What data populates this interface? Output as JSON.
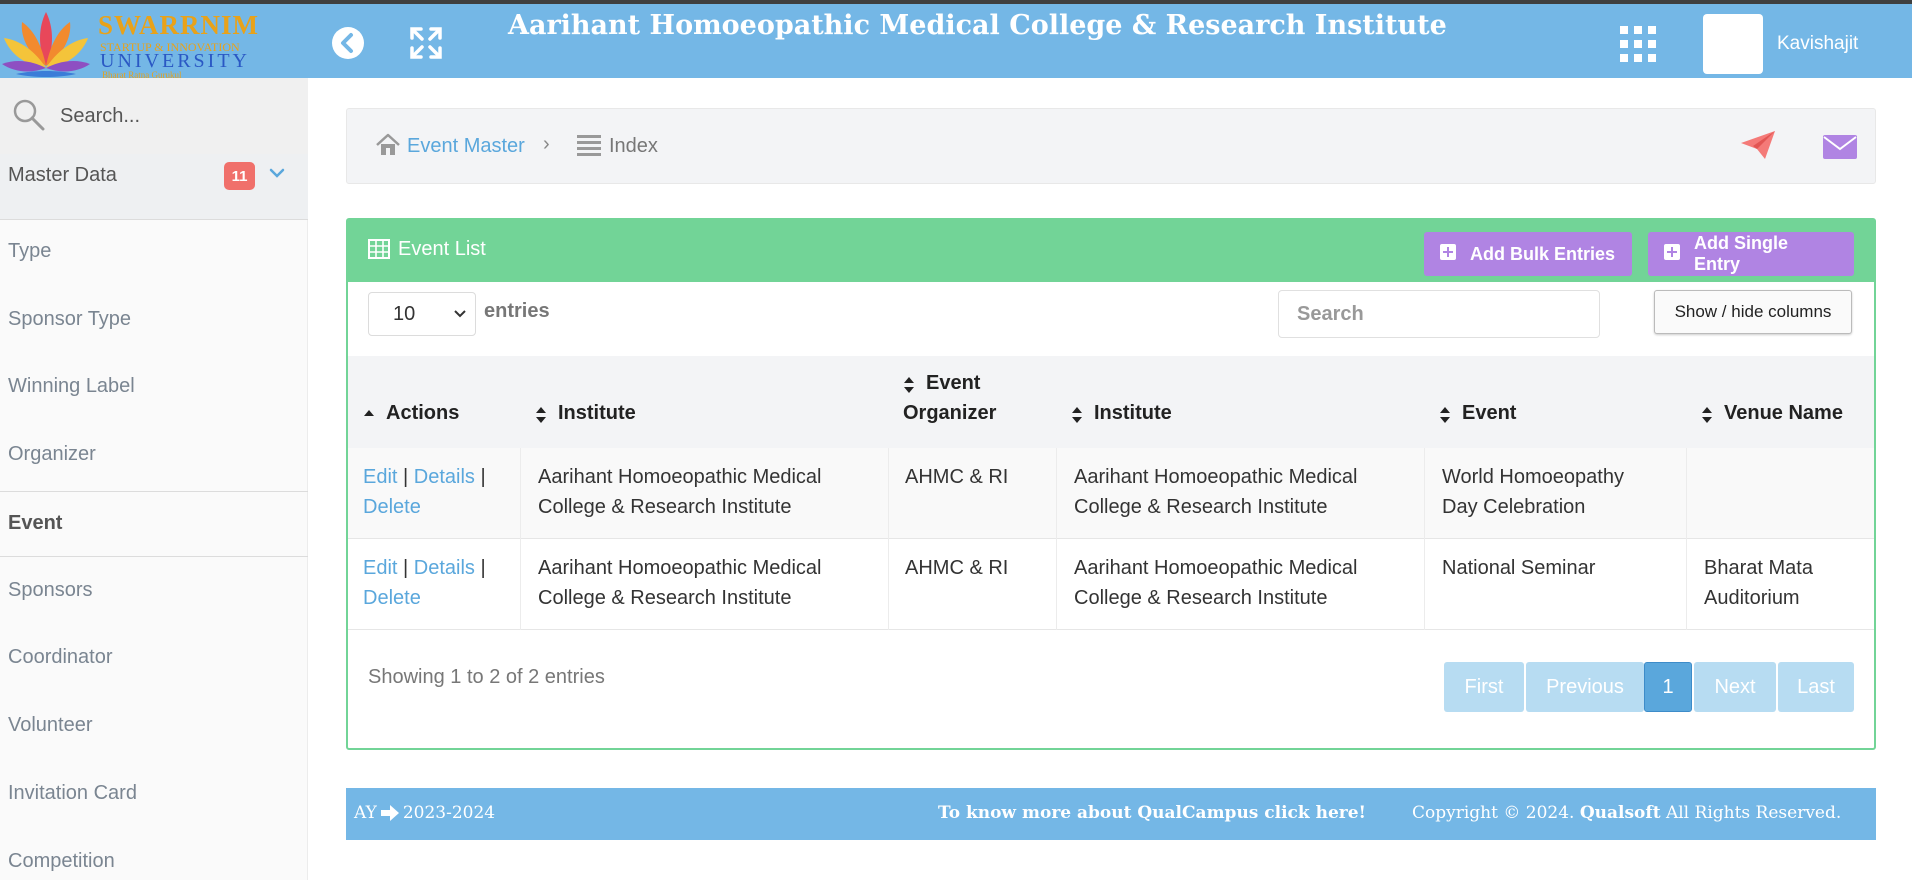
{
  "header": {
    "logo": {
      "line1": "SWARRNIM",
      "line2": "STARTUP & INNOVATION",
      "line3": "UNIVERSITY",
      "tagline": "Bharat Ratna Gurukul"
    },
    "title": "Aarihant Homoeopathic Medical College & Research Institute",
    "username": "Kavishajit",
    "colors": {
      "bar": "#74b7e6",
      "logo_gold": "#e8a21a",
      "logo_blue": "#2a58c4"
    },
    "icons": [
      "back-circle-icon",
      "fullscreen-icon",
      "apps-grid-icon"
    ]
  },
  "sidebar": {
    "search_placeholder": "Search...",
    "group": {
      "label": "Master Data",
      "badge": "11"
    },
    "items": [
      {
        "label": "Type"
      },
      {
        "label": "Sponsor Type"
      },
      {
        "label": "Winning Label"
      },
      {
        "label": "Organizer"
      },
      {
        "label": "Event",
        "active": true
      },
      {
        "label": "Sponsors"
      },
      {
        "label": "Coordinator"
      },
      {
        "label": "Volunteer"
      },
      {
        "label": "Invitation Card"
      },
      {
        "label": "Competition"
      }
    ]
  },
  "breadcrumb": {
    "link": "Event Master",
    "current": "Index",
    "icons": [
      "home-icon",
      "list-icon",
      "paper-plane-icon",
      "envelope-icon"
    ]
  },
  "panel": {
    "title": "Event List",
    "add_bulk_label": "Add Bulk Entries",
    "add_single_label": "Add Single Entry",
    "length_value": "10",
    "entries_label": "entries",
    "search_placeholder": "Search",
    "show_hide_label": "Show / hide columns",
    "colors": {
      "header": "#72d497",
      "button": "#b084e3"
    }
  },
  "table": {
    "columns": [
      {
        "label": "Actions",
        "line2": ""
      },
      {
        "label": "Institute",
        "line2": ""
      },
      {
        "label": "Event",
        "line2": "Organizer"
      },
      {
        "label": "Institute",
        "line2": ""
      },
      {
        "label": "Event",
        "line2": ""
      },
      {
        "label": "Venue Name",
        "line2": ""
      }
    ],
    "actions": {
      "edit": "Edit",
      "details": "Details",
      "delete": "Delete",
      "sep": "|"
    },
    "rows": [
      {
        "institute_1": "Aarihant Homoeopathic Medical",
        "institute_2": "College & Research Institute",
        "organizer": "AHMC & RI",
        "inst2_1": "Aarihant Homoeopathic Medical",
        "inst2_2": "College & Research Institute",
        "event_1": "World Homoeopathy",
        "event_2": "Day Celebration",
        "venue_1": "",
        "venue_2": ""
      },
      {
        "institute_1": "Aarihant Homoeopathic Medical",
        "institute_2": "College & Research Institute",
        "organizer": "AHMC & RI",
        "inst2_1": "Aarihant Homoeopathic Medical",
        "inst2_2": "College & Research Institute",
        "event_1": "National Seminar",
        "event_2": "",
        "venue_1": "Bharat Mata",
        "venue_2": "Auditorium"
      }
    ],
    "info": "Showing 1 to 2 of 2 entries",
    "pagination": {
      "first": "First",
      "previous": "Previous",
      "current": "1",
      "next": "Next",
      "last": "Last"
    }
  },
  "footer": {
    "ay_label": "AY",
    "ay_value": "2023-2024",
    "more_link": "To know more about QualCampus click here!",
    "copyright_pre": "Copyright © 2024.",
    "copyright_brand": "Qualsoft",
    "copyright_post": "All Rights Reserved."
  }
}
